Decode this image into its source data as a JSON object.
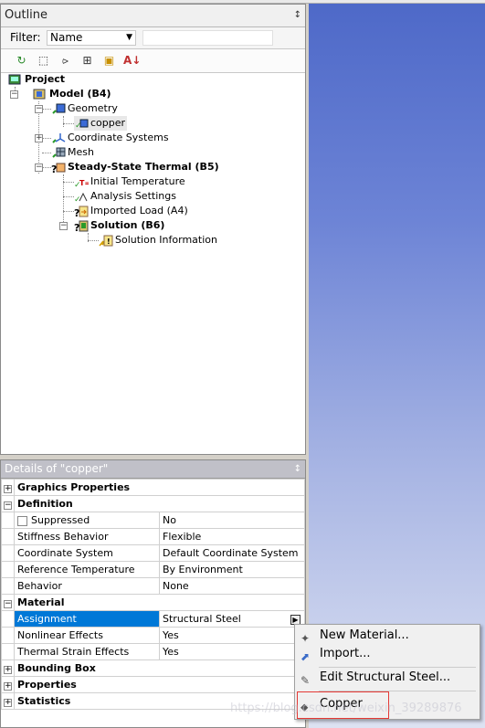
{
  "outline": {
    "title": "Outline",
    "pin": "⌲",
    "filter_label": "Filter:",
    "filter_value": "Name",
    "filter_text": "",
    "toolbar_icons": [
      "refresh-icon",
      "eraser-icon",
      "tree-expand-icon",
      "plus-box-icon",
      "folder-icon",
      "sort-az-icon"
    ],
    "tree": {
      "project": "Project",
      "model": "Model (B4)",
      "geometry": "Geometry",
      "copper": "copper",
      "coordinate_systems": "Coordinate Systems",
      "mesh": "Mesh",
      "steady_state": "Steady-State Thermal (B5)",
      "initial_temperature": "Initial Temperature",
      "analysis_settings": "Analysis Settings",
      "imported_load": "Imported Load (A4)",
      "solution": "Solution (B6)",
      "solution_information": "Solution Information"
    }
  },
  "details": {
    "title": "Details of \"copper\"",
    "rows": {
      "graphics_properties": "Graphics Properties",
      "definition": "Definition",
      "suppressed_label": "Suppressed",
      "suppressed_value": "No",
      "stiffness_label": "Stiffness Behavior",
      "stiffness_value": "Flexible",
      "coord_label": "Coordinate System",
      "coord_value": "Default Coordinate System",
      "reftemp_label": "Reference Temperature",
      "reftemp_value": "By Environment",
      "behavior_label": "Behavior",
      "behavior_value": "None",
      "material": "Material",
      "assignment_label": "Assignment",
      "assignment_value": "Structural Steel",
      "nonlinear_label": "Nonlinear Effects",
      "nonlinear_value": "Yes",
      "thermal_label": "Thermal Strain Effects",
      "thermal_value": "Yes",
      "bounding_box": "Bounding Box",
      "properties": "Properties",
      "statistics": "Statistics"
    }
  },
  "context_menu": {
    "new_material": "New Material...",
    "import": "Import...",
    "edit_structural_steel": "Edit Structural Steel...",
    "copper": "Copper"
  },
  "watermark": "https://blog.csdn.net/weixin_39289876",
  "colors": {
    "selection": "#0078d7",
    "highlight_box": "#e53935",
    "viewport_top": "#4e69c8",
    "viewport_bottom": "#dde2f2"
  }
}
